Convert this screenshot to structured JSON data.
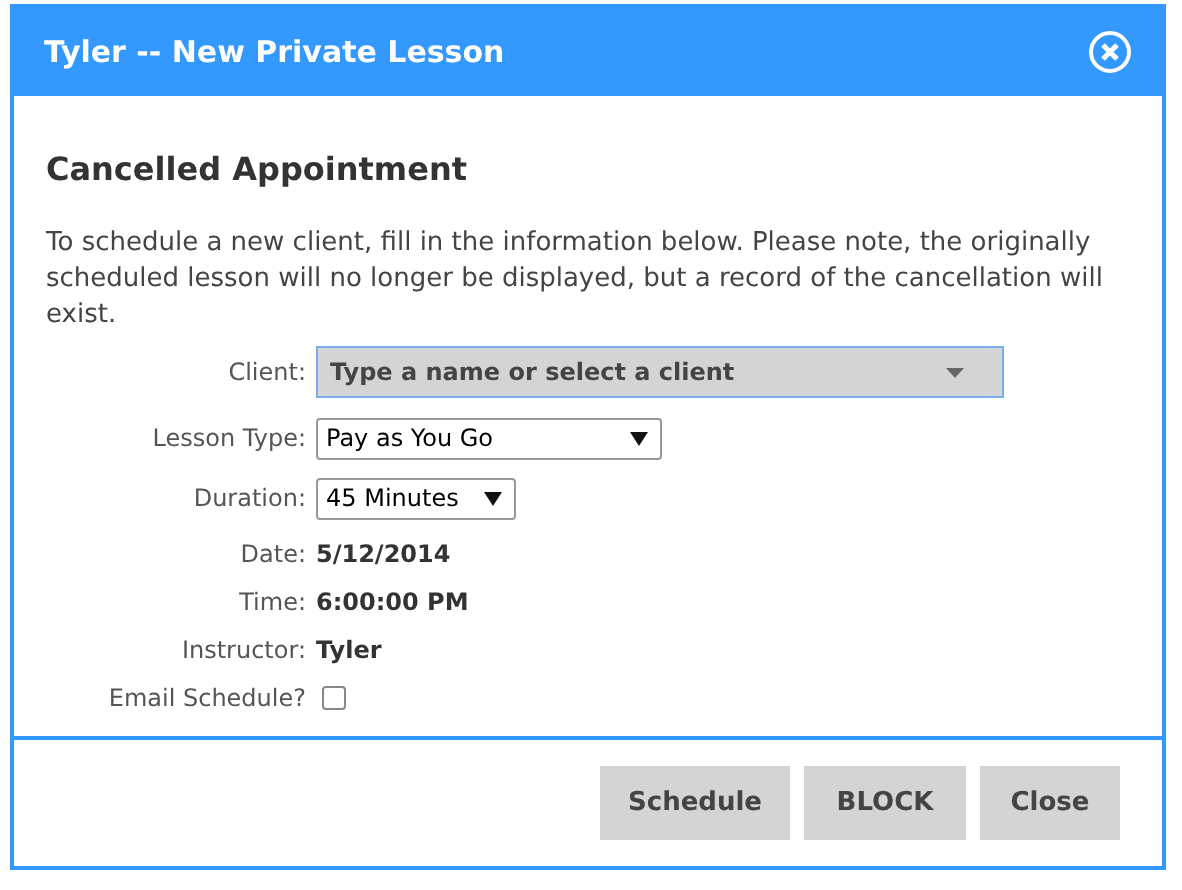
{
  "dialog": {
    "title": "Tyler -- New Private Lesson"
  },
  "heading": "Cancelled Appointment",
  "intro": "To schedule a new client, fill in the information below. Please note, the originally scheduled lesson will no longer be displayed, but a record of the cancellation will exist.",
  "fields": [
    {
      "kind": "combo",
      "label": "Client:",
      "placeholder": "Type a name or select a client"
    },
    {
      "kind": "select",
      "label": "Lesson Type:",
      "value": "Pay as You Go"
    },
    {
      "kind": "select",
      "label": "Duration:",
      "value": "45 Minutes"
    },
    {
      "kind": "text",
      "label": "Date:",
      "value": "5/12/2014"
    },
    {
      "kind": "text",
      "label": "Time:",
      "value": "6:00:00 PM"
    },
    {
      "kind": "text",
      "label": "Instructor:",
      "value": "Tyler"
    },
    {
      "kind": "checkbox",
      "label": "Email Schedule?",
      "checked": false
    }
  ],
  "buttons": [
    "Schedule",
    "BLOCK",
    "Close"
  ]
}
